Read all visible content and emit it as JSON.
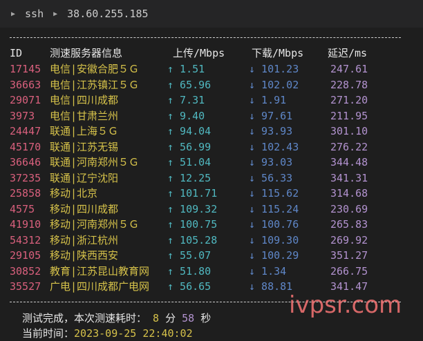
{
  "breadcrumb": {
    "items": [
      "ssh",
      "38.60.255.185"
    ]
  },
  "separator": "--------------------------------------------------------------------",
  "table": {
    "headers": {
      "id": "ID",
      "name": "测速服务器信息",
      "up": "上传/Mbps",
      "down": "下载/Mbps",
      "latency": "延迟/ms"
    },
    "rows": [
      {
        "id": "17145",
        "name": "电信|安徽合肥５Ｇ",
        "up": "↑ 1.51",
        "down": "↓ 101.23",
        "latency": "247.61"
      },
      {
        "id": "36663",
        "name": "电信|江苏镇江５Ｇ",
        "up": "↑ 65.96",
        "down": "↓ 102.02",
        "latency": "228.78"
      },
      {
        "id": "29071",
        "name": "电信|四川成都",
        "up": "↑ 7.31",
        "down": "↓ 1.91",
        "latency": "271.20"
      },
      {
        "id": "3973",
        "name": "电信|甘肃兰州",
        "up": "↑ 9.40",
        "down": "↓ 97.61",
        "latency": "211.95"
      },
      {
        "id": "24447",
        "name": "联通|上海５Ｇ",
        "up": "↑ 94.04",
        "down": "↓ 93.93",
        "latency": "301.10"
      },
      {
        "id": "45170",
        "name": "联通|江苏无锡",
        "up": "↑ 56.99",
        "down": "↓ 102.43",
        "latency": "276.22"
      },
      {
        "id": "36646",
        "name": "联通|河南郑州５Ｇ",
        "up": "↑ 51.04",
        "down": "↓ 93.03",
        "latency": "344.48"
      },
      {
        "id": "37235",
        "name": "联通|辽宁沈阳",
        "up": "↑ 12.25",
        "down": "↓ 56.33",
        "latency": "341.31"
      },
      {
        "id": "25858",
        "name": "移动|北京",
        "up": "↑ 101.71",
        "down": "↓ 115.62",
        "latency": "314.68"
      },
      {
        "id": "4575",
        "name": "移动|四川成都",
        "up": "↑ 109.32",
        "down": "↓ 115.24",
        "latency": "230.69"
      },
      {
        "id": "41910",
        "name": "移动|河南郑州５Ｇ",
        "up": "↑ 100.75",
        "down": "↓ 100.76",
        "latency": "265.83"
      },
      {
        "id": "54312",
        "name": "移动|浙江杭州",
        "up": "↑ 105.28",
        "down": "↓ 109.30",
        "latency": "269.92"
      },
      {
        "id": "29105",
        "name": "移动|陕西西安",
        "up": "↑ 55.07",
        "down": "↓ 100.29",
        "latency": "351.27"
      },
      {
        "id": "30852",
        "name": "教育|江苏昆山教育网",
        "up": "↑ 51.80",
        "down": "↓ 1.34",
        "latency": "266.75"
      },
      {
        "id": "35527",
        "name": "广电|四川成都广电网",
        "up": "↑ 56.65",
        "down": "↓ 88.81",
        "latency": "341.47"
      }
    ]
  },
  "footer": {
    "complete_label": "测试完成，本次测速耗时：",
    "minutes": "8",
    "minutes_unit": "分",
    "seconds": "58",
    "seconds_unit": "秒",
    "time_label": "当前时间：",
    "time_value": "2023-09-25 22:40:02"
  },
  "watermark": "ivpsr.com",
  "colors": {
    "id": "#d9607d",
    "name": "#d6c24a",
    "up": "#50b8c0",
    "down": "#5f87c8",
    "latency": "#b393d0"
  }
}
